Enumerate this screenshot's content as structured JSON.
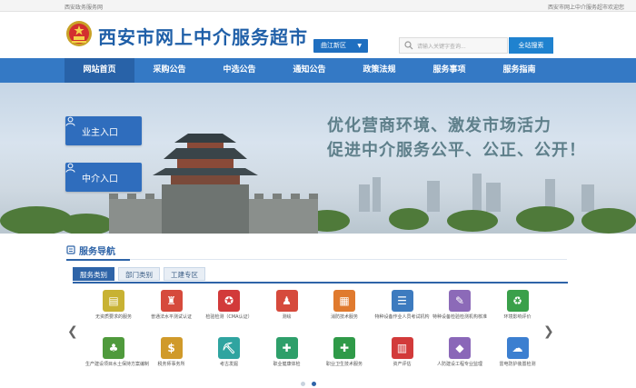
{
  "topbar": {
    "left_text": "西安政务服务网",
    "right_text": "西安市网上中介服务超市欢迎您"
  },
  "header": {
    "title": "西安市网上中介服务超市",
    "region_select": "曲江新区",
    "search_placeholder": "请输入关键字查询...",
    "search_button": "全站搜索"
  },
  "nav": {
    "items": [
      "网站首页",
      "采购公告",
      "中选公告",
      "通知公告",
      "政策法规",
      "服务事项",
      "服务指南"
    ],
    "active": "网站首页"
  },
  "banner": {
    "owner_entry": "业主入口",
    "agency_entry": "中介入口",
    "slogan_line1": "优化营商环境、激发市场活力",
    "slogan_line2": "促进中介服务公平、公正、公开！"
  },
  "service_nav": {
    "title": "服务导航",
    "tabs": [
      "服务类别",
      "部门类别",
      "工建专区"
    ],
    "active_tab": "服务类别",
    "items": [
      {
        "label": "无资质要求的服务",
        "icon": "certificate-icon",
        "color": "#c8b233"
      },
      {
        "label": "普通法水平测试认证",
        "icon": "stamp-icon",
        "color": "#d64a3c"
      },
      {
        "label": "检验检测（CMA认证）",
        "icon": "seal-icon",
        "color": "#d23a3a"
      },
      {
        "label": "测绘",
        "icon": "survey-icon",
        "color": "#d64a3c"
      },
      {
        "label": "消防技术服务",
        "icon": "document-icon",
        "color": "#e07a2e"
      },
      {
        "label": "特种设备作业人员考试机构",
        "icon": "checklist-icon",
        "color": "#3d7bbf"
      },
      {
        "label": "特种设备检验检测机构核准",
        "icon": "edit-icon",
        "color": "#8c6ab8"
      },
      {
        "label": "环境影响评价",
        "icon": "recycle-icon",
        "color": "#3aa04a"
      },
      {
        "label": "生产建设项目水土保持方案编制",
        "icon": "tree-icon",
        "color": "#4f9a3c"
      },
      {
        "label": "税务师事务所",
        "icon": "money-bag-icon",
        "color": "#d09a2a"
      },
      {
        "label": "考古发掘",
        "icon": "archaeology-icon",
        "color": "#2fa4a0"
      },
      {
        "label": "职业健康体检",
        "icon": "medical-kit-icon",
        "color": "#2e9f6a"
      },
      {
        "label": "职业卫生技术服务",
        "icon": "first-aid-icon",
        "color": "#2f9a48"
      },
      {
        "label": "资产评估",
        "icon": "report-icon",
        "color": "#d23a3a"
      },
      {
        "label": "人防建设工程专业监理",
        "icon": "shield-icon",
        "color": "#8a67b8"
      },
      {
        "label": "雷电防护装置检测",
        "icon": "cloud-icon",
        "color": "#3c7fd0"
      }
    ]
  },
  "carousel": {
    "pages": 2,
    "current": 2
  }
}
